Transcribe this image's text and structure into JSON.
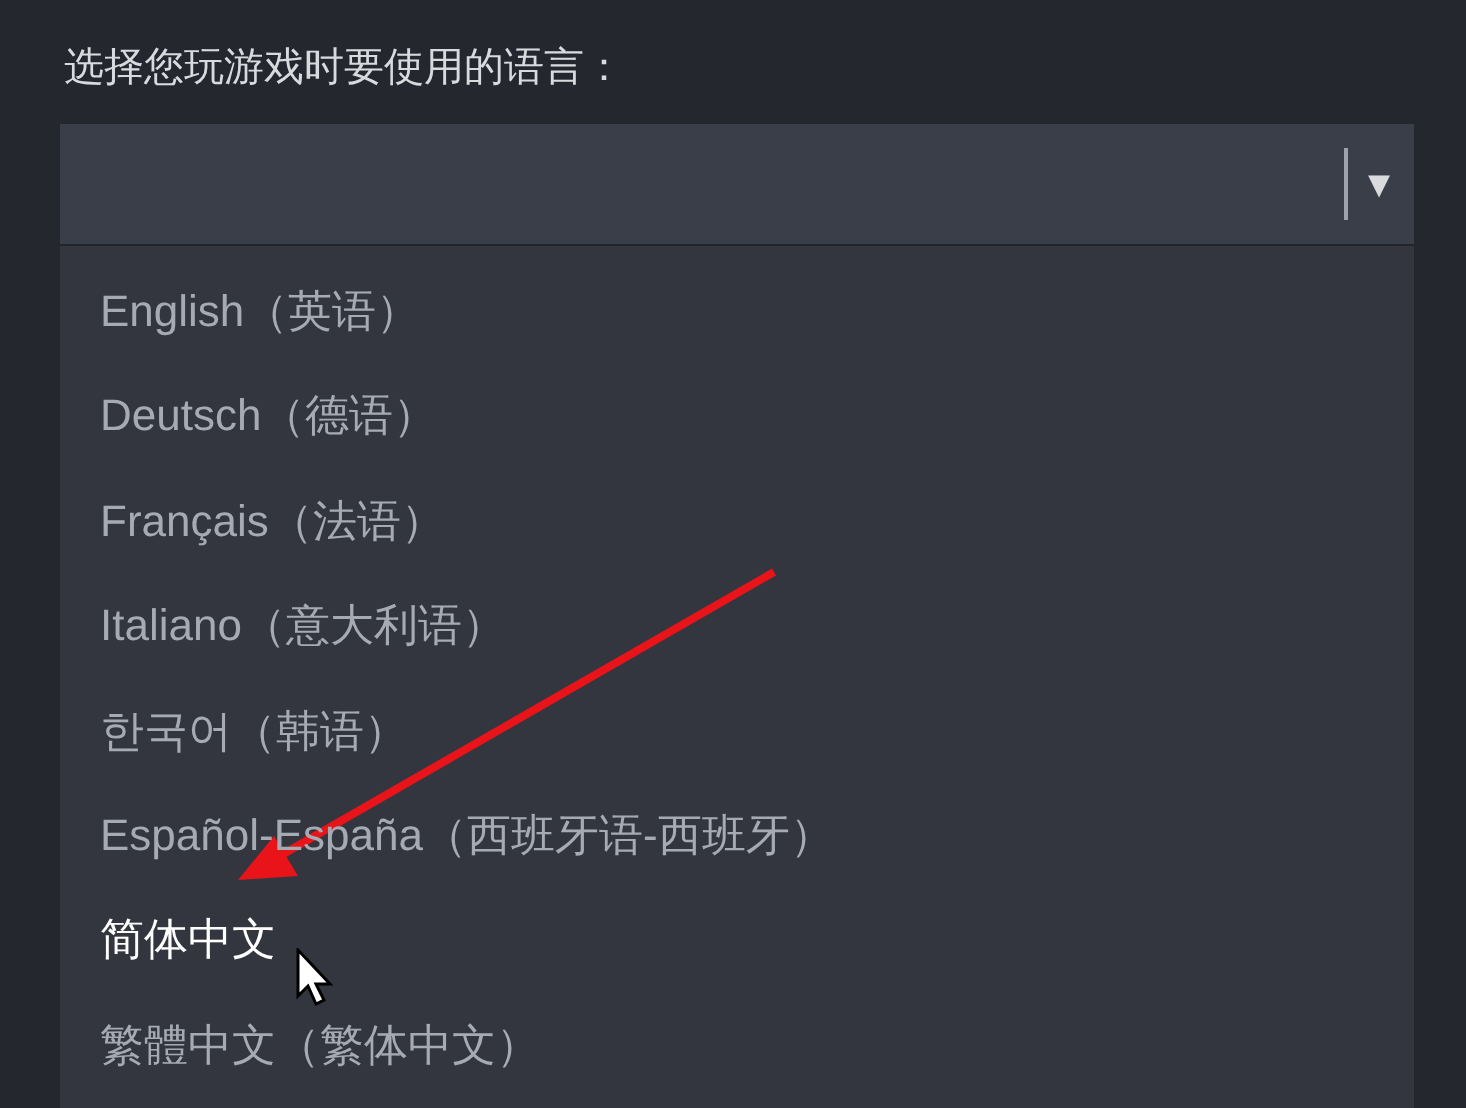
{
  "prompt": "选择您玩游戏时要使用的语言：",
  "dropdown": {
    "caret": "▾"
  },
  "options": [
    {
      "label": "English（英语）",
      "selected": false
    },
    {
      "label": "Deutsch（德语）",
      "selected": false
    },
    {
      "label": "Français（法语）",
      "selected": false
    },
    {
      "label": "Italiano（意大利语）",
      "selected": false
    },
    {
      "label": "한국어（韩语）",
      "selected": false
    },
    {
      "label": "Español-España（西班牙语-西班牙）",
      "selected": false
    },
    {
      "label": "简体中文",
      "selected": true
    },
    {
      "label": "繁體中文（繁体中文）",
      "selected": false
    }
  ]
}
